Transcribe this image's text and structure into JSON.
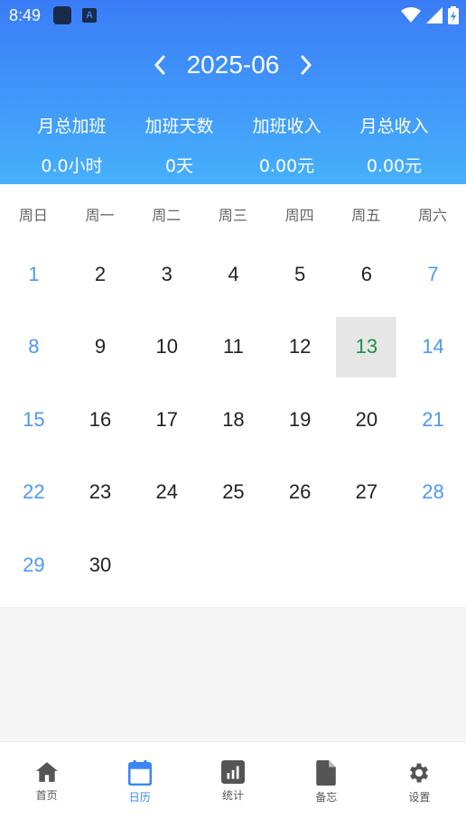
{
  "status_bar": {
    "time": "8:49",
    "icon_letter": "A"
  },
  "header": {
    "month": "2025-06",
    "summary": [
      {
        "label": "月总加班",
        "value": "0.0小时"
      },
      {
        "label": "加班天数",
        "value": "0天"
      },
      {
        "label": "加班收入",
        "value": "0.00元"
      },
      {
        "label": "月总收入",
        "value": "0.00元"
      }
    ]
  },
  "calendar": {
    "weekdays": [
      "周日",
      "周一",
      "周二",
      "周三",
      "周四",
      "周五",
      "周六"
    ],
    "first_weekday_index": 0,
    "days_in_month": 30,
    "today": 13,
    "colors": {
      "weekend": "#4a9af0",
      "today": "#1a8f4a",
      "today_bg": "#e6e6e6"
    }
  },
  "bottom_nav": {
    "active": "日历",
    "tabs": [
      {
        "label": "首页",
        "icon": "home-icon"
      },
      {
        "label": "日历",
        "icon": "calendar-icon"
      },
      {
        "label": "统计",
        "icon": "chart-icon"
      },
      {
        "label": "备忘",
        "icon": "document-icon"
      },
      {
        "label": "设置",
        "icon": "gear-icon"
      }
    ]
  },
  "colors": {
    "header_top": "#3a7cf7",
    "header_bottom": "#46b0fb",
    "accent": "#3a86f5"
  }
}
